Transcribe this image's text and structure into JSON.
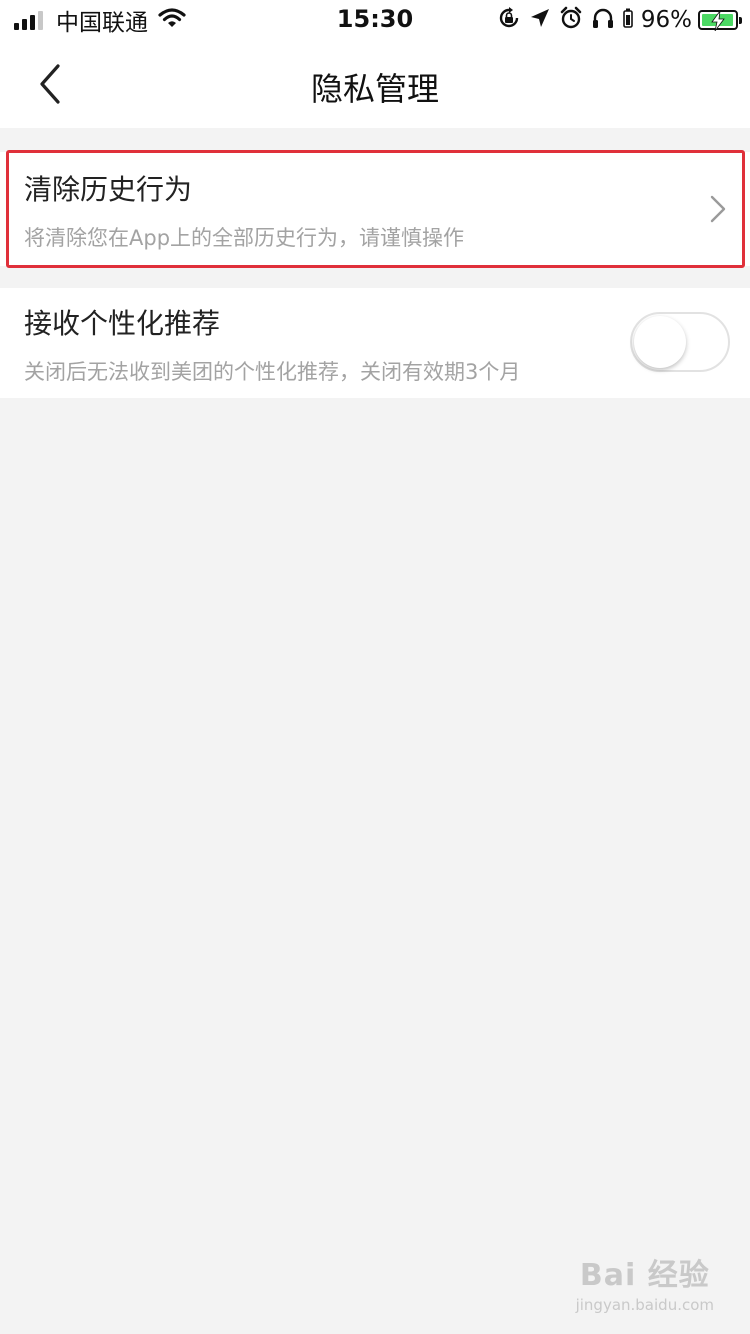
{
  "status_bar": {
    "carrier": "中国联通",
    "time": "15:30",
    "battery": "96%",
    "battery_level": 0.96,
    "icons": [
      "signal-icon",
      "wifi-icon",
      "orientation-lock-icon",
      "location-icon",
      "alarm-icon",
      "headphones-icon",
      "battery-icon"
    ],
    "battery_color": "#4cd964"
  },
  "nav": {
    "title": "隐私管理",
    "back_icon": "chevron-left-icon"
  },
  "items": [
    {
      "title": "清除历史行为",
      "subtitle": "将清除您在App上的全部历史行为，请谨慎操作",
      "accessory": "chevron-right-icon",
      "highlighted": true,
      "highlight_color": "#e0303a"
    },
    {
      "title": "接收个性化推荐",
      "subtitle": "关闭后无法收到美团的个性化推荐，关闭有效期3个月",
      "accessory": "toggle",
      "toggle_on": false
    }
  ],
  "watermark": {
    "main": "Bai 经验",
    "url": "jingyan.baidu.com"
  },
  "colors": {
    "background": "#f3f3f3",
    "card": "#ffffff",
    "subtitle": "#a3a3a3"
  }
}
